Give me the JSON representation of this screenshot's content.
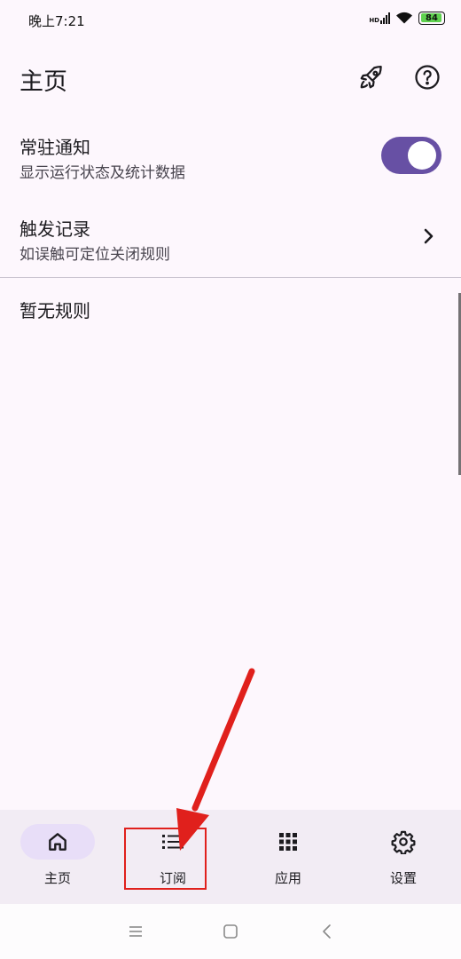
{
  "status_bar": {
    "time": "晚上7:21",
    "network_label": "HD",
    "battery": "84"
  },
  "app_bar": {
    "title": "主页"
  },
  "settings_list": {
    "notify": {
      "title": "常驻通知",
      "subtitle": "显示运行状态及统计数据",
      "enabled": true
    },
    "trigger_log": {
      "title": "触发记录",
      "subtitle": "如误触可定位关闭规则"
    },
    "empty_state": "暂无规则"
  },
  "bottom_nav": {
    "items": [
      {
        "label": "主页",
        "icon": "home-icon",
        "active": true
      },
      {
        "label": "订阅",
        "icon": "list-icon",
        "active": false
      },
      {
        "label": "应用",
        "icon": "grid-icon",
        "active": false
      },
      {
        "label": "设置",
        "icon": "gear-icon",
        "active": false
      }
    ]
  },
  "colors": {
    "accent": "#6750a4",
    "active_indicator": "#e8def8",
    "nav_background": "#f2ecf4",
    "annotation": "#e0201c"
  }
}
